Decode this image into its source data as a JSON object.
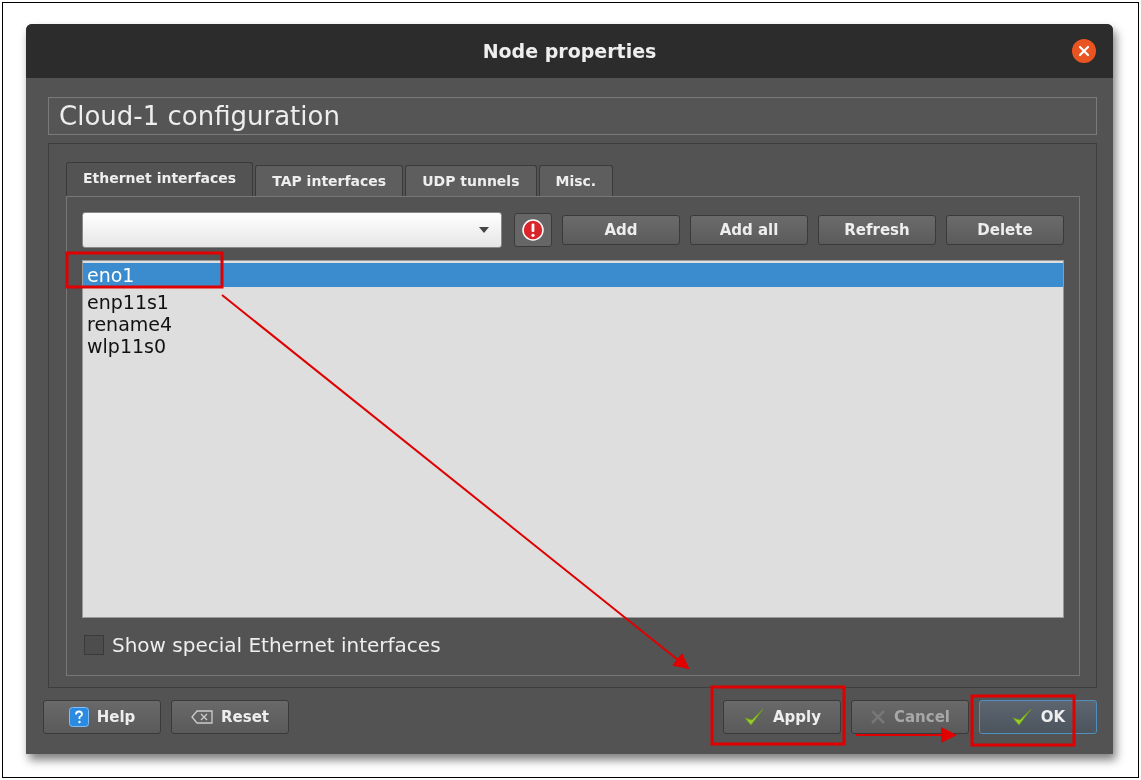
{
  "window": {
    "title": "Node properties"
  },
  "header": "Cloud-1 configuration",
  "tabs": [
    {
      "label": "Ethernet interfaces",
      "selected": true
    },
    {
      "label": "TAP interfaces",
      "selected": false
    },
    {
      "label": "UDP tunnels",
      "selected": false
    },
    {
      "label": "Misc.",
      "selected": false
    }
  ],
  "toolbar": {
    "buttons": [
      {
        "label": "Add"
      },
      {
        "label": "Add all"
      },
      {
        "label": "Refresh"
      },
      {
        "label": "Delete"
      }
    ]
  },
  "interfaces": [
    {
      "name": "eno1",
      "selected": true
    },
    {
      "name": "enp11s1",
      "selected": false
    },
    {
      "name": "rename4",
      "selected": false
    },
    {
      "name": "wlp11s0",
      "selected": false
    }
  ],
  "show_special": {
    "label": "Show special Ethernet interfaces",
    "checked": false
  },
  "left_buttons": [
    {
      "label": "Help",
      "kind": "help"
    },
    {
      "label": "Reset",
      "kind": "reset"
    }
  ],
  "right_buttons": [
    {
      "label": "Apply",
      "kind": "apply",
      "disabled": false,
      "default": false
    },
    {
      "label": "Cancel",
      "kind": "cancel",
      "disabled": true,
      "default": false
    },
    {
      "label": "OK",
      "kind": "ok",
      "disabled": false,
      "default": true
    }
  ]
}
